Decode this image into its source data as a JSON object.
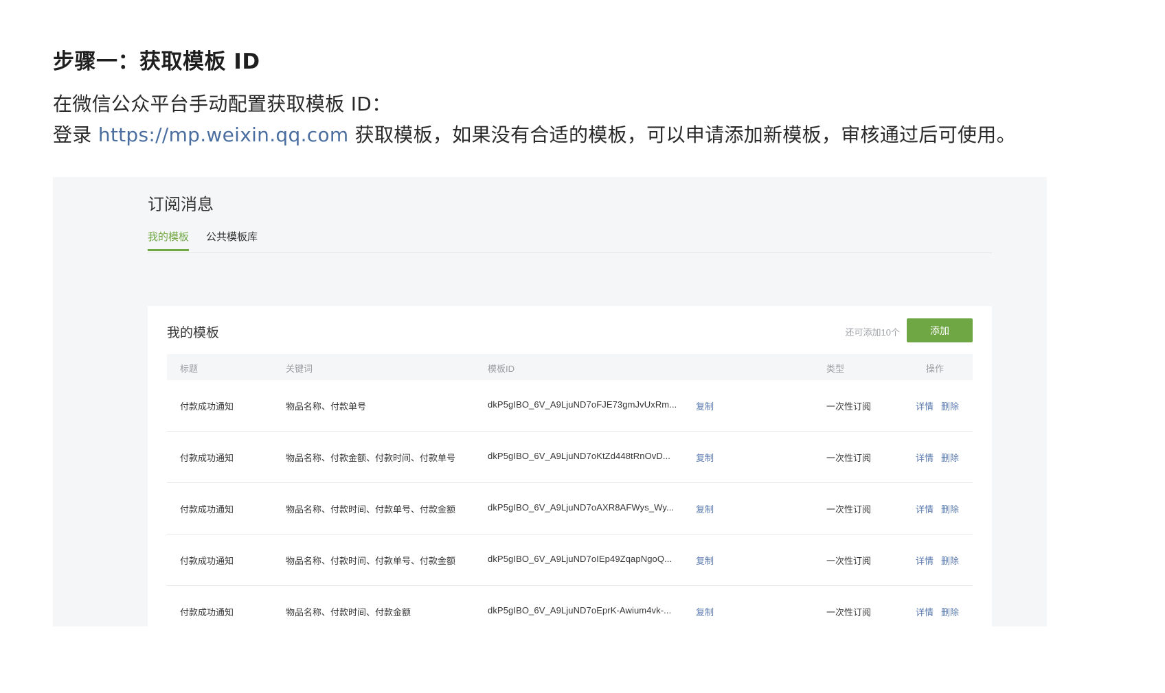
{
  "doc": {
    "step_title": "步骤一：获取模板 ID",
    "line1": "在微信公众平台手动配置获取模板 ID：",
    "line2_prefix": "登录 ",
    "link_text": "https://mp.weixin.qq.com",
    "line2_suffix": " 获取模板，如果没有合适的模板，可以申请添加新模板，审核通过后可使用。"
  },
  "screenshot": {
    "title": "订阅消息",
    "tabs": [
      {
        "label": "我的模板",
        "active": true
      },
      {
        "label": "公共模板库",
        "active": false
      }
    ],
    "card": {
      "title": "我的模板",
      "remaining": "还可添加10个",
      "add_button": "添加",
      "columns": [
        "标题",
        "关键词",
        "模板ID",
        "类型",
        "操作"
      ],
      "rows": [
        {
          "title": "付款成功通知",
          "keywords": "物品名称、付款单号",
          "template_id": "dkP5gIBO_6V_A9LjuND7oFJE73gmJvUxRm...",
          "copy": "复制",
          "type": "一次性订阅",
          "detail": "详情",
          "delete": "删除"
        },
        {
          "title": "付款成功通知",
          "keywords": "物品名称、付款金额、付款时间、付款单号",
          "template_id": "dkP5gIBO_6V_A9LjuND7oKtZd448tRnOvD...",
          "copy": "复制",
          "type": "一次性订阅",
          "detail": "详情",
          "delete": "删除"
        },
        {
          "title": "付款成功通知",
          "keywords": "物品名称、付款时间、付款单号、付款金额",
          "template_id": "dkP5gIBO_6V_A9LjuND7oAXR8AFWys_Wy...",
          "copy": "复制",
          "type": "一次性订阅",
          "detail": "详情",
          "delete": "删除"
        },
        {
          "title": "付款成功通知",
          "keywords": "物品名称、付款时间、付款单号、付款金额",
          "template_id": "dkP5gIBO_6V_A9LjuND7oIEp49ZqapNgoQ...",
          "copy": "复制",
          "type": "一次性订阅",
          "detail": "详情",
          "delete": "删除"
        },
        {
          "title": "付款成功通知",
          "keywords": "物品名称、付款时间、付款金额",
          "template_id": "dkP5gIBO_6V_A9LjuND7oEprK-Awium4vk-...",
          "copy": "复制",
          "type": "一次性订阅",
          "detail": "详情",
          "delete": "删除"
        }
      ]
    }
  },
  "colors": {
    "accent_green": "#6fa744",
    "link_blue": "#4a6ea0",
    "panel_bg": "#f5f6f7"
  }
}
